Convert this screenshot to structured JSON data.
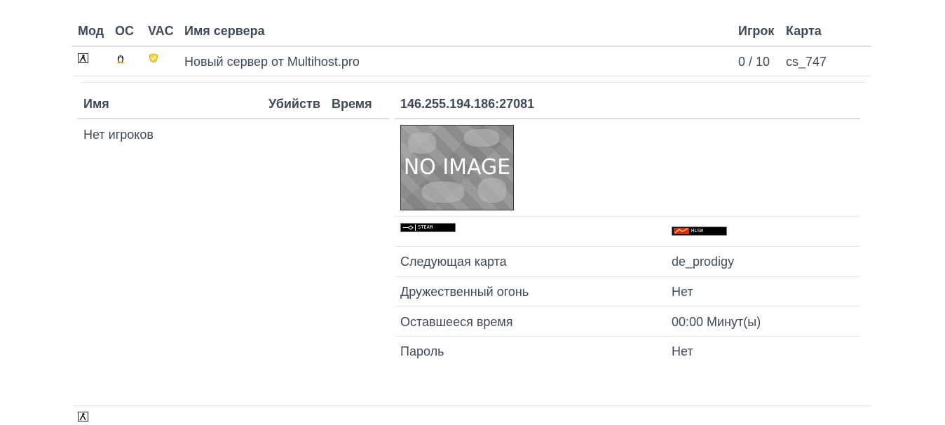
{
  "table": {
    "headers": {
      "mod": "Мод",
      "os": "ОС",
      "vac": "VAC",
      "server_name": "Имя сервера",
      "players": "Игрок",
      "map": "Карта"
    },
    "row": {
      "mod_icon": "cs-mod-icon",
      "os_icon": "linux-tux-icon",
      "vac_icon": "vac-shield-icon",
      "server_name": "Новый сервер от Multihost.pro",
      "players": "0 / 10",
      "map": "cs_747"
    },
    "next_row_partial": {
      "mod_icon": "cs-mod-icon"
    }
  },
  "details": {
    "players_panel": {
      "headers": {
        "name": "Имя",
        "kills": "Убийств",
        "time": "Время"
      },
      "empty_text": "Нет игроков"
    },
    "server_panel": {
      "address": "146.255.194.186:27081",
      "map_image_text": "NO IMAGE",
      "steam_badge": "STEAM",
      "hlsw_badge": "HLSW",
      "rows": [
        {
          "label": "Следующая карта",
          "value": "de_prodigy"
        },
        {
          "label": "Дружественный огонь",
          "value": "Нет"
        },
        {
          "label": "Оставшееся время",
          "value": "00:00 Минут(ы)"
        },
        {
          "label": "Пароль",
          "value": "Нет"
        }
      ]
    }
  }
}
